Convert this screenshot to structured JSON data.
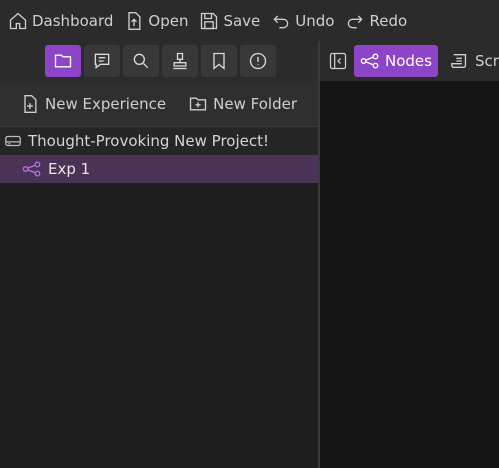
{
  "toolbar": {
    "dashboard": "Dashboard",
    "open": "Open",
    "save": "Save",
    "undo": "Undo",
    "redo": "Redo"
  },
  "sidebar": {
    "icons": [
      "folder-icon",
      "comments-icon",
      "search-icon",
      "stamp-icon",
      "bookmark-icon",
      "alert-icon"
    ],
    "active_icon": "folder-icon",
    "actions": {
      "new_experience": "New Experience",
      "new_folder": "New Folder"
    },
    "tree": {
      "project": "Thought-Provoking New Project!",
      "items": [
        {
          "label": "Exp 1",
          "selected": true
        }
      ]
    }
  },
  "editor": {
    "tabs": [
      {
        "label": "Nodes",
        "active": true
      },
      {
        "label": "Scri"
      }
    ]
  },
  "colors": {
    "accent": "#8e44c6",
    "selected_row": "#4b3257",
    "background": "#1f1f1f"
  }
}
